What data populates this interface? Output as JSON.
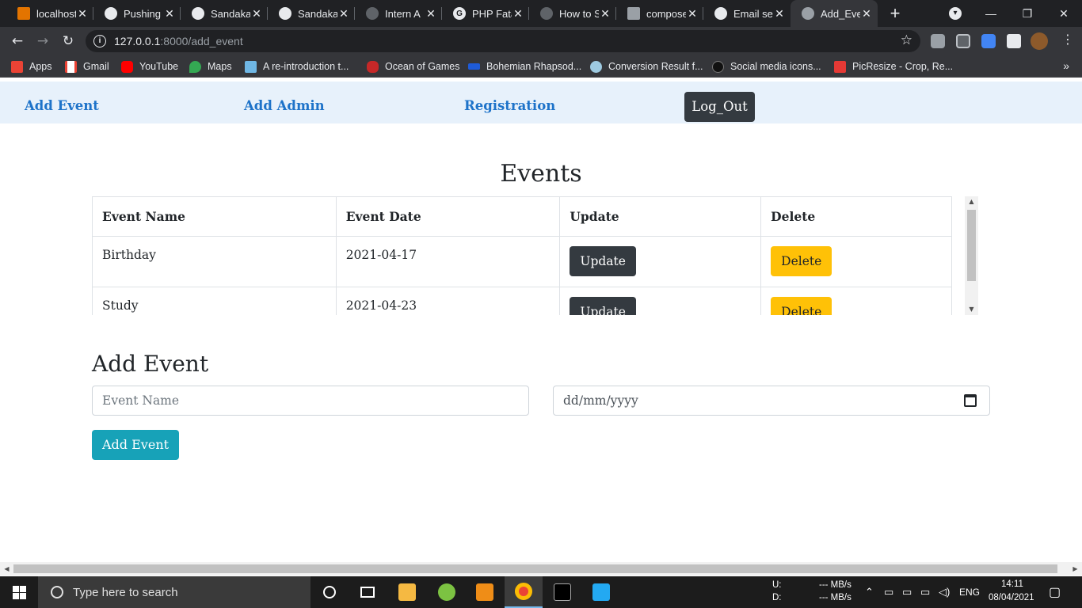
{
  "browser": {
    "tabs": [
      {
        "title": "localhost",
        "color": "#e37400"
      },
      {
        "title": "Pushing",
        "color": "#e8eaed"
      },
      {
        "title": "Sandaka",
        "color": "#e8eaed"
      },
      {
        "title": "Sandaka",
        "color": "#e8eaed"
      },
      {
        "title": "Intern A",
        "color": "#5f6368"
      },
      {
        "title": "PHP Fata",
        "color": "#e8eaed"
      },
      {
        "title": "How to S",
        "color": "#5f6368"
      },
      {
        "title": "compose",
        "color": "#9aa0a6"
      },
      {
        "title": "Email se",
        "color": "#e8eaed"
      },
      {
        "title": "Add_Eve",
        "color": "#9aa0a6"
      }
    ],
    "url_host": "127.0.0.1",
    "url_path": ":8000/add_event",
    "bookmarks": [
      {
        "label": "Apps",
        "color": "#ea4335"
      },
      {
        "label": "Gmail",
        "color": "#ffffff"
      },
      {
        "label": "YouTube",
        "color": "#ff0000"
      },
      {
        "label": "Maps",
        "color": "#34a853"
      },
      {
        "label": "A re-introduction t...",
        "color": "#6fb7e5"
      },
      {
        "label": "Ocean of Games",
        "color": "#c62828"
      },
      {
        "label": "Bohemian Rhapsod...",
        "color": "#1e5bd8"
      },
      {
        "label": "Conversion Result f...",
        "color": "#9ecae1"
      },
      {
        "label": "Social media icons...",
        "color": "#111111"
      },
      {
        "label": "PicResize - Crop, Re...",
        "color": "#e53935"
      }
    ]
  },
  "nav": {
    "links": [
      "Add Event",
      "Add Admin",
      "Registration"
    ],
    "logout": "Log_Out"
  },
  "events": {
    "title": "Events",
    "columns": [
      "Event Name",
      "Event Date",
      "Update",
      "Delete"
    ],
    "rows": [
      {
        "name": "Birthday",
        "date": "2021-04-17",
        "update": "Update",
        "delete": "Delete"
      },
      {
        "name": "Study",
        "date": "2021-04-23",
        "update": "Update",
        "delete": "Delete"
      }
    ]
  },
  "add_event": {
    "title": "Add Event",
    "name_placeholder": "Event Name",
    "date_placeholder": "dd/mm/yyyy",
    "submit": "Add Event"
  },
  "taskbar": {
    "search_placeholder": "Type here to search",
    "net_up_label": "U:",
    "net_down_label": "D:",
    "net_up_value": "--- MB/s",
    "net_down_value": "--- MB/s",
    "language": "ENG",
    "time": "14:11",
    "date": "08/04/2021"
  }
}
